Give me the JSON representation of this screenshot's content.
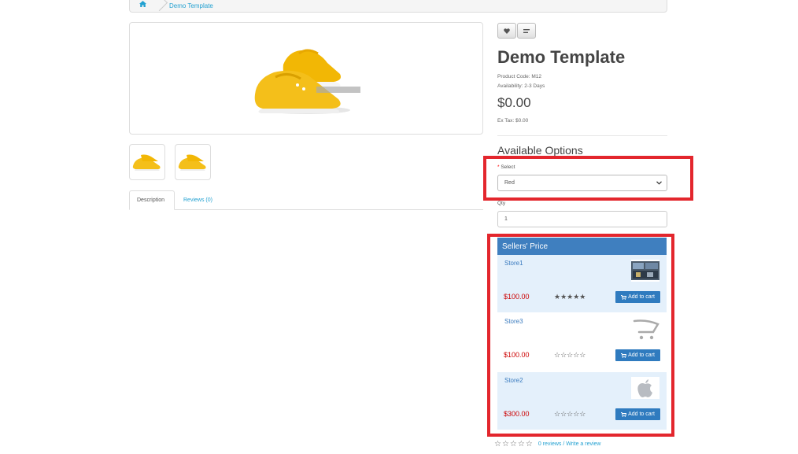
{
  "breadcrumb": {
    "items": [
      "Demo Template"
    ]
  },
  "product": {
    "title": "Demo Template",
    "code": "Product Code: M12",
    "availability": "Availability: 2-3 Days",
    "price": "$0.00",
    "ex_tax": "Ex Tax: $0.00"
  },
  "tabs": {
    "description": "Description",
    "reviews": "Reviews (0)"
  },
  "options": {
    "heading": "Available Options",
    "select_label": "Select",
    "select_required": "*",
    "select_value": "Red",
    "qty_label": "Qty",
    "qty_value": "1"
  },
  "sellers": {
    "heading": "Sellers' Price",
    "cart_label": "Add to cart",
    "rows": [
      {
        "name": "Store1",
        "price": "$100.00",
        "stars": "★★★★★",
        "logo": "store-photo"
      },
      {
        "name": "Store3",
        "price": "$100.00",
        "stars": "☆☆☆☆☆",
        "logo": "cart-icon"
      },
      {
        "name": "Store2",
        "price": "$300.00",
        "stars": "☆☆☆☆☆",
        "logo": "apple-icon"
      }
    ]
  },
  "reviews": {
    "stars": "☆☆☆☆☆",
    "count_link": "0 reviews",
    "separator": "/",
    "write_link": "Write a review"
  },
  "colors": {
    "accent": "#3f7fbf",
    "price_red": "#cc0000",
    "highlight": "#e3262d",
    "row_alt": "#e4f0fb"
  },
  "icons": {
    "home": "home-icon",
    "wishlist": "heart-icon",
    "compare": "compare-icon"
  }
}
